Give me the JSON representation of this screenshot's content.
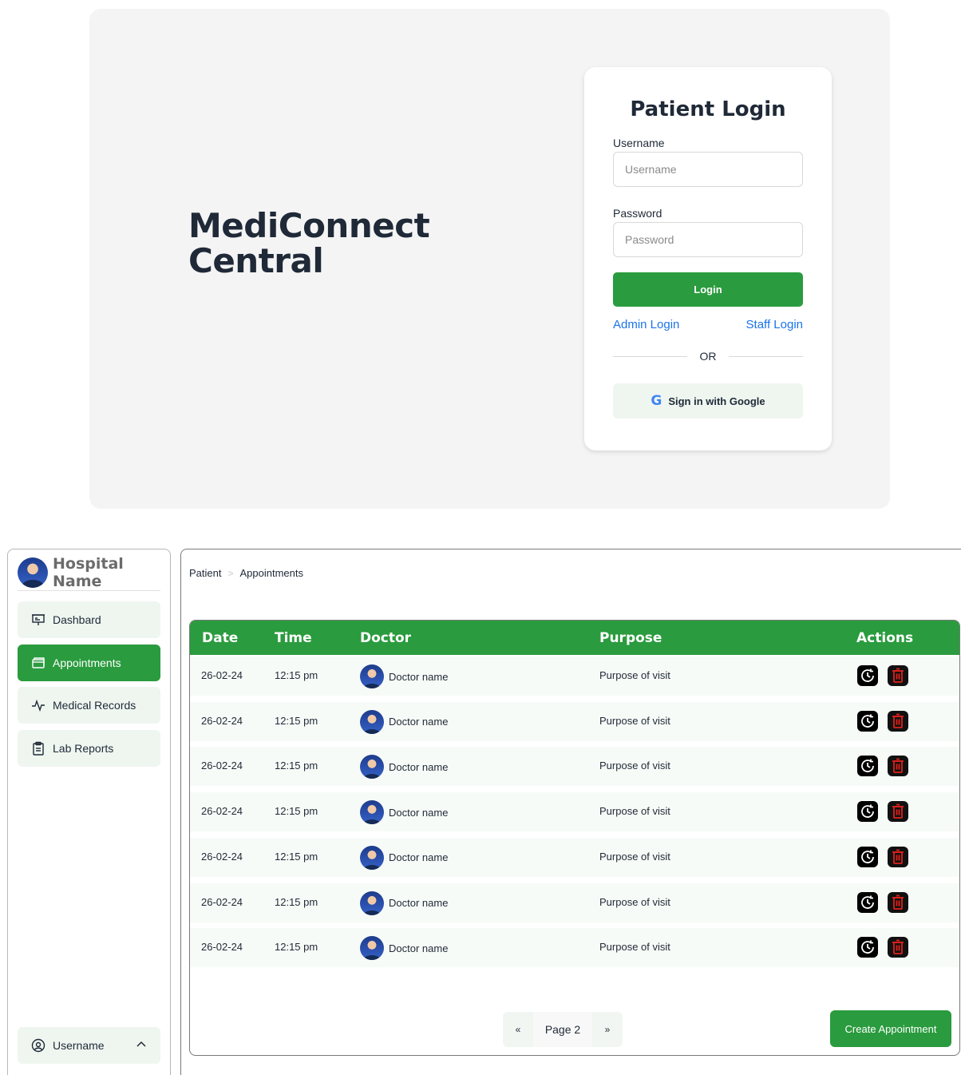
{
  "login": {
    "brand": "MediConnect\nCentral",
    "title": "Patient Login",
    "username_label": "Username",
    "username_placeholder": "Username",
    "password_label": "Password",
    "password_placeholder": "Password",
    "login_button": "Login",
    "admin_link": "Admin Login",
    "staff_link": "Staff Login",
    "or_text": "OR",
    "google_button": "Sign in with Google"
  },
  "sidebar": {
    "hospital_name": "Hospital Name",
    "items": [
      {
        "label": "Dashbard",
        "icon": "presentation-board-icon",
        "active": false
      },
      {
        "label": "Appointments",
        "icon": "cards-icon",
        "active": true
      },
      {
        "label": "Medical Records",
        "icon": "activity-pulse-icon",
        "active": false
      },
      {
        "label": "Lab Reports",
        "icon": "clipboard-icon",
        "active": false
      }
    ],
    "user": {
      "label": "Username",
      "icon": "user-circle-icon"
    }
  },
  "main": {
    "breadcrumb": [
      "Patient",
      "Appointments"
    ],
    "table": {
      "headers": [
        "Date",
        "Time",
        "Doctor",
        "Purpose",
        "Actions"
      ],
      "rows": [
        {
          "date": "26-02-24",
          "time": "12:15 pm",
          "doctor": "Doctor name",
          "purpose": "Purpose of visit"
        },
        {
          "date": "26-02-24",
          "time": "12:15 pm",
          "doctor": "Doctor name",
          "purpose": "Purpose of visit"
        },
        {
          "date": "26-02-24",
          "time": "12:15 pm",
          "doctor": "Doctor name",
          "purpose": "Purpose of visit"
        },
        {
          "date": "26-02-24",
          "time": "12:15 pm",
          "doctor": "Doctor name",
          "purpose": "Purpose of visit"
        },
        {
          "date": "26-02-24",
          "time": "12:15 pm",
          "doctor": "Doctor name",
          "purpose": "Purpose of visit"
        },
        {
          "date": "26-02-24",
          "time": "12:15 pm",
          "doctor": "Doctor name",
          "purpose": "Purpose of visit"
        },
        {
          "date": "26-02-24",
          "time": "12:15 pm",
          "doctor": "Doctor name",
          "purpose": "Purpose of visit"
        }
      ]
    },
    "pagination": {
      "prev": "«",
      "label": "Page 2",
      "next": "»"
    },
    "create_button": "Create Appointment"
  },
  "colors": {
    "accent": "#2a9b3e",
    "link": "#1a73e8",
    "danger": "#e0201a"
  }
}
